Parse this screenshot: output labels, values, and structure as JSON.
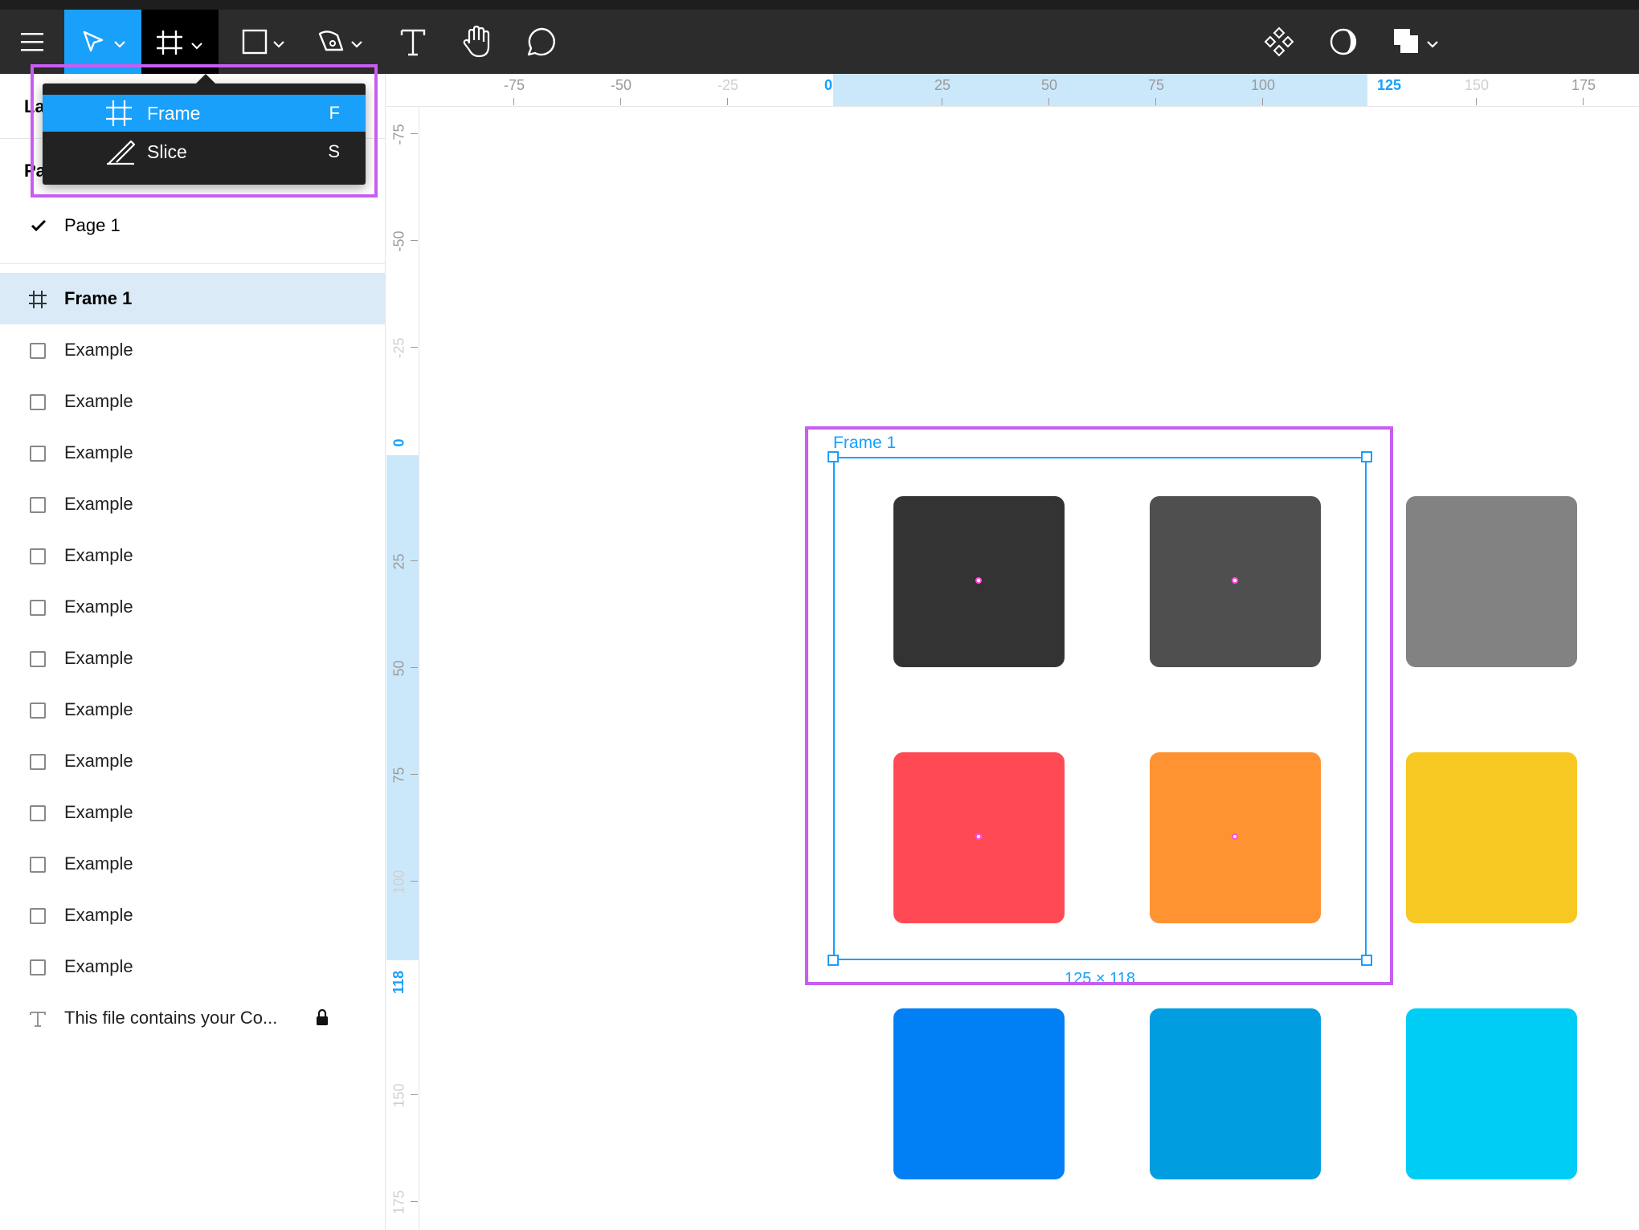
{
  "toolbar": {
    "tools": [
      {
        "name": "main-menu-icon"
      },
      {
        "name": "move-tool-icon",
        "active": true
      },
      {
        "name": "frame-tool-icon",
        "active": true
      },
      {
        "name": "rectangle-tool-icon"
      },
      {
        "name": "pen-tool-icon"
      },
      {
        "name": "text-tool-icon"
      },
      {
        "name": "hand-tool-icon"
      },
      {
        "name": "comment-tool-icon"
      },
      {
        "name": "component-icon"
      },
      {
        "name": "mask-icon"
      },
      {
        "name": "boolean-groups-icon"
      }
    ],
    "accent_color": "#18a0fb"
  },
  "tool_dropdown": {
    "items": [
      {
        "label": "Frame",
        "shortcut": "F",
        "icon": "frame-icon",
        "active": true
      },
      {
        "label": "Slice",
        "shortcut": "S",
        "icon": "slice-icon",
        "active": false
      }
    ]
  },
  "left_panel": {
    "layers_heading": "La",
    "pages_heading": "Pa",
    "pages": [
      {
        "label": "Page 1",
        "selected": true
      }
    ],
    "layers": [
      {
        "label": "Frame 1",
        "icon": "frame-icon",
        "selected": true
      },
      {
        "label": "Example",
        "icon": "rectangle-icon"
      },
      {
        "label": "Example",
        "icon": "rectangle-icon"
      },
      {
        "label": "Example",
        "icon": "rectangle-icon"
      },
      {
        "label": "Example",
        "icon": "rectangle-icon"
      },
      {
        "label": "Example",
        "icon": "rectangle-icon"
      },
      {
        "label": "Example",
        "icon": "rectangle-icon"
      },
      {
        "label": "Example",
        "icon": "rectangle-icon"
      },
      {
        "label": "Example",
        "icon": "rectangle-icon"
      },
      {
        "label": "Example",
        "icon": "rectangle-icon"
      },
      {
        "label": "Example",
        "icon": "rectangle-icon"
      },
      {
        "label": "Example",
        "icon": "rectangle-icon"
      },
      {
        "label": "Example",
        "icon": "rectangle-icon"
      },
      {
        "label": "Example",
        "icon": "rectangle-icon"
      },
      {
        "label": "This file contains your Co...",
        "icon": "text-icon",
        "locked": true
      }
    ]
  },
  "rulers": {
    "horizontal": [
      "-75",
      "-50",
      "-25",
      "0",
      "25",
      "50",
      "75",
      "100",
      "125",
      "150",
      "175"
    ],
    "vertical": [
      "-75",
      "-50",
      "-25",
      "0",
      "25",
      "50",
      "75",
      "100",
      "118",
      "150",
      "175"
    ],
    "selection_start": "0",
    "selection_end_x": "125",
    "selection_end_y": "118"
  },
  "canvas": {
    "frame": {
      "name": "Frame 1",
      "size_label": "125 × 118"
    },
    "swatch_colors": [
      [
        "#333333",
        "#4f4f4f",
        "#828282"
      ],
      [
        "#ff4a55",
        "#ff9332",
        "#f8c822"
      ],
      [
        "#0080f4",
        "#009ee0",
        "#00cdf5"
      ]
    ],
    "highlight_color": "#c75df1"
  }
}
